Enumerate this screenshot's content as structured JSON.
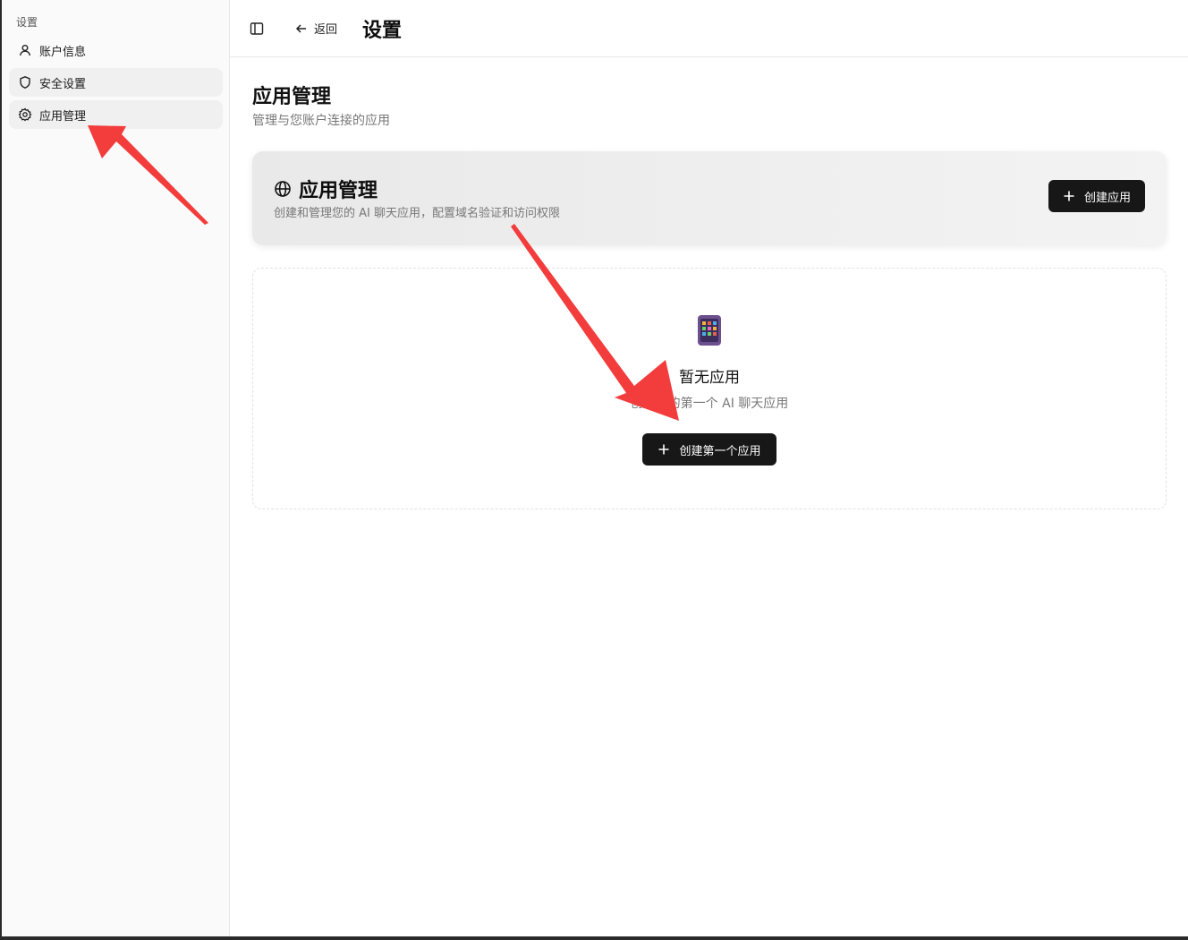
{
  "sidebar": {
    "group_label": "设置",
    "items": [
      {
        "label": "账户信息",
        "icon": "user-icon"
      },
      {
        "label": "安全设置",
        "icon": "shield-icon"
      },
      {
        "label": "应用管理",
        "icon": "gear-icon"
      }
    ]
  },
  "header": {
    "back_label": "返回",
    "title": "设置"
  },
  "main": {
    "title": "应用管理",
    "subtitle": "管理与您账户连接的应用",
    "card": {
      "title": "应用管理",
      "icon": "globe-icon",
      "description": "创建和管理您的 AI 聊天应用，配置域名验证和访问权限",
      "create_button": "创建应用"
    },
    "empty_state": {
      "icon": "app-grid-icon",
      "title": "暂无应用",
      "description": "创建您的第一个 AI 聊天应用",
      "button": "创建第一个应用"
    }
  },
  "colors": {
    "accent_dark": "#171717",
    "annotation_arrow": "#f33c3c"
  }
}
